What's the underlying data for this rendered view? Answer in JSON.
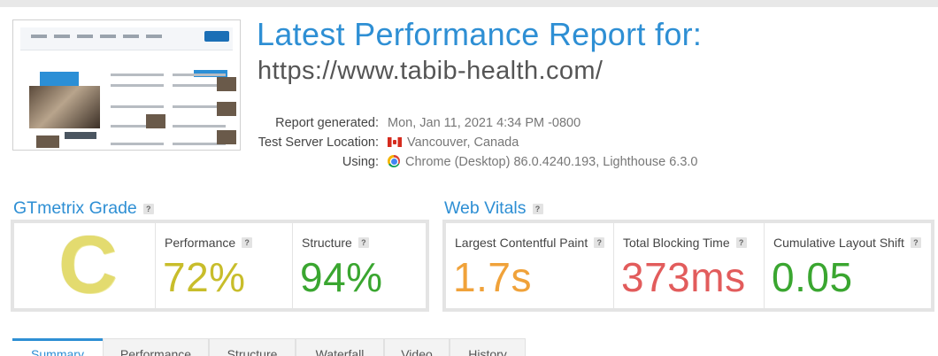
{
  "header": {
    "title": "Latest Performance Report for:",
    "url": "https://www.tabib-health.com/"
  },
  "meta": {
    "report_generated": {
      "label": "Report generated:",
      "value": "Mon, Jan 11, 2021 4:34 PM -0800"
    },
    "test_server": {
      "label": "Test Server Location:",
      "value": "Vancouver, Canada",
      "icon": "canada-flag-icon"
    },
    "using": {
      "label": "Using:",
      "value": "Chrome (Desktop) 86.0.4240.193, Lighthouse 6.3.0",
      "icon": "chrome-icon"
    }
  },
  "gtmetrix_grade": {
    "heading": "GTmetrix Grade",
    "help": "?",
    "grade": "C",
    "grade_color": "#e3db6f",
    "performance": {
      "label": "Performance",
      "help": "?",
      "value": "72%",
      "color": "#c8bd2b"
    },
    "structure": {
      "label": "Structure",
      "help": "?",
      "value": "94%",
      "color": "#3aa630"
    }
  },
  "web_vitals": {
    "heading": "Web Vitals",
    "help": "?",
    "lcp": {
      "label": "Largest Contentful Paint",
      "help": "?",
      "value": "1.7s",
      "color": "#f0a23a"
    },
    "tbt": {
      "label": "Total Blocking Time",
      "help": "?",
      "value": "373ms",
      "color": "#e25c5c"
    },
    "cls": {
      "label": "Cumulative Layout Shift",
      "help": "?",
      "value": "0.05",
      "color": "#3aa630"
    }
  },
  "tabs": [
    {
      "label": "Summary",
      "active": true
    },
    {
      "label": "Performance",
      "active": false
    },
    {
      "label": "Structure",
      "active": false
    },
    {
      "label": "Waterfall",
      "active": false
    },
    {
      "label": "Video",
      "active": false
    },
    {
      "label": "History",
      "active": false
    }
  ],
  "colors": {
    "accent": "#2e8fd4"
  }
}
